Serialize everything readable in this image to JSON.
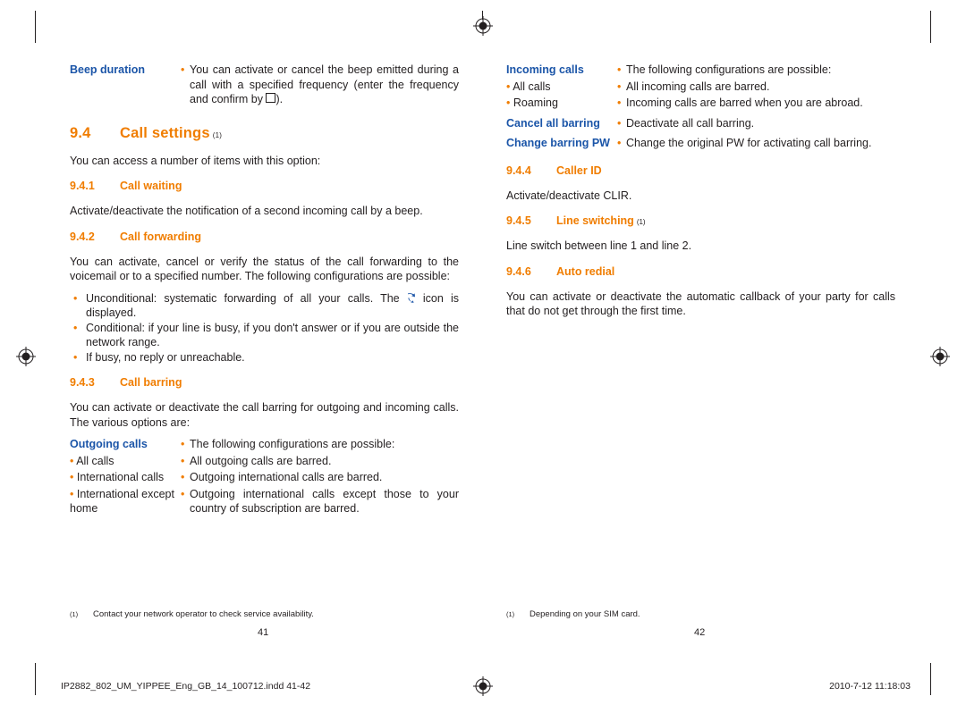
{
  "document": {
    "left_page": {
      "beep": {
        "term": "Beep duration",
        "bullet": "•",
        "text_before_box": "You can activate or cancel the beep emitted during a call with a specified frequency (enter the frequency and confirm by ",
        "text_after_box": ")."
      },
      "section": {
        "number": "9.4",
        "title": "Call settings",
        "footnote_mark": "(1)"
      },
      "intro": "You can access a number of items with this option:",
      "sub1": {
        "number": "9.4.1",
        "title": "Call waiting",
        "body": "Activate/deactivate the notification of a second incoming call by a beep."
      },
      "sub2": {
        "number": "9.4.2",
        "title": "Call forwarding",
        "body": "You can activate, cancel or verify the status of the call forwarding to the voicemail or to a specified number. The following configurations are possible:",
        "bullets": [
          {
            "before": "Unconditional: systematic forwarding of all your calls. The ",
            "icon": "call-forward-icon",
            "after": " icon is displayed."
          },
          {
            "before": "Conditional: if your line is busy, if you don't answer or if you are outside the network range.",
            "icon": "",
            "after": ""
          },
          {
            "before": "If busy, no reply or unreachable.",
            "icon": "",
            "after": ""
          }
        ]
      },
      "sub3": {
        "number": "9.4.3",
        "title": "Call barring",
        "body": "You can activate or deactivate the call barring for outgoing and incoming calls. The various options are:",
        "rows": [
          {
            "term": "Outgoing calls",
            "term_style": "blue",
            "bullet": "•",
            "desc": "The following configurations are possible:"
          },
          {
            "term": "All calls",
            "term_style": "sub",
            "bullet": "•",
            "desc": "All outgoing calls are barred."
          },
          {
            "term": "International calls",
            "term_style": "sub",
            "bullet": "•",
            "desc": "Outgoing international calls are barred."
          },
          {
            "term": "International except home",
            "term_style": "sub",
            "bullet": "•",
            "desc": "Outgoing international calls except those to your country of subscription are barred."
          }
        ]
      },
      "footnote": {
        "mark": "(1)",
        "text": "Contact your network operator to check service availability."
      },
      "folio": "41"
    },
    "right_page": {
      "rows": [
        {
          "term": "Incoming calls",
          "term_style": "blue",
          "bullet": "•",
          "desc": "The following configurations are possible:"
        },
        {
          "term": "All calls",
          "term_style": "sub",
          "bullet": "•",
          "desc": "All incoming calls are barred."
        },
        {
          "term": "Roaming",
          "term_style": "sub",
          "bullet": "•",
          "desc": "Incoming calls are barred when you are abroad."
        },
        {
          "term": "Cancel all barring",
          "term_style": "blue",
          "bullet": "•",
          "desc": "Deactivate all call barring."
        },
        {
          "term": "Change barring PW",
          "term_style": "blue",
          "bullet": "•",
          "desc": "Change the original PW for activating call barring."
        }
      ],
      "sub4": {
        "number": "9.4.4",
        "title": "Caller ID",
        "body": "Activate/deactivate CLIR."
      },
      "sub5": {
        "number": "9.4.5",
        "title": "Line switching",
        "footnote_mark": "(1)",
        "body": "Line switch between line 1 and line 2."
      },
      "sub6": {
        "number": "9.4.6",
        "title": "Auto redial",
        "body": "You can activate or deactivate the automatic callback of your party for calls that do not get through the first time."
      },
      "footnote": {
        "mark": "(1)",
        "text": "Depending on your SIM card."
      },
      "folio": "42"
    },
    "slug": {
      "left": "IP2882_802_UM_YIPPEE_Eng_GB_14_100712.indd   41-42",
      "right": "2010-7-12   11:18:03"
    },
    "colors": {
      "heading": "#f07d00",
      "term": "#1b55a8",
      "body": "#231f20"
    }
  }
}
